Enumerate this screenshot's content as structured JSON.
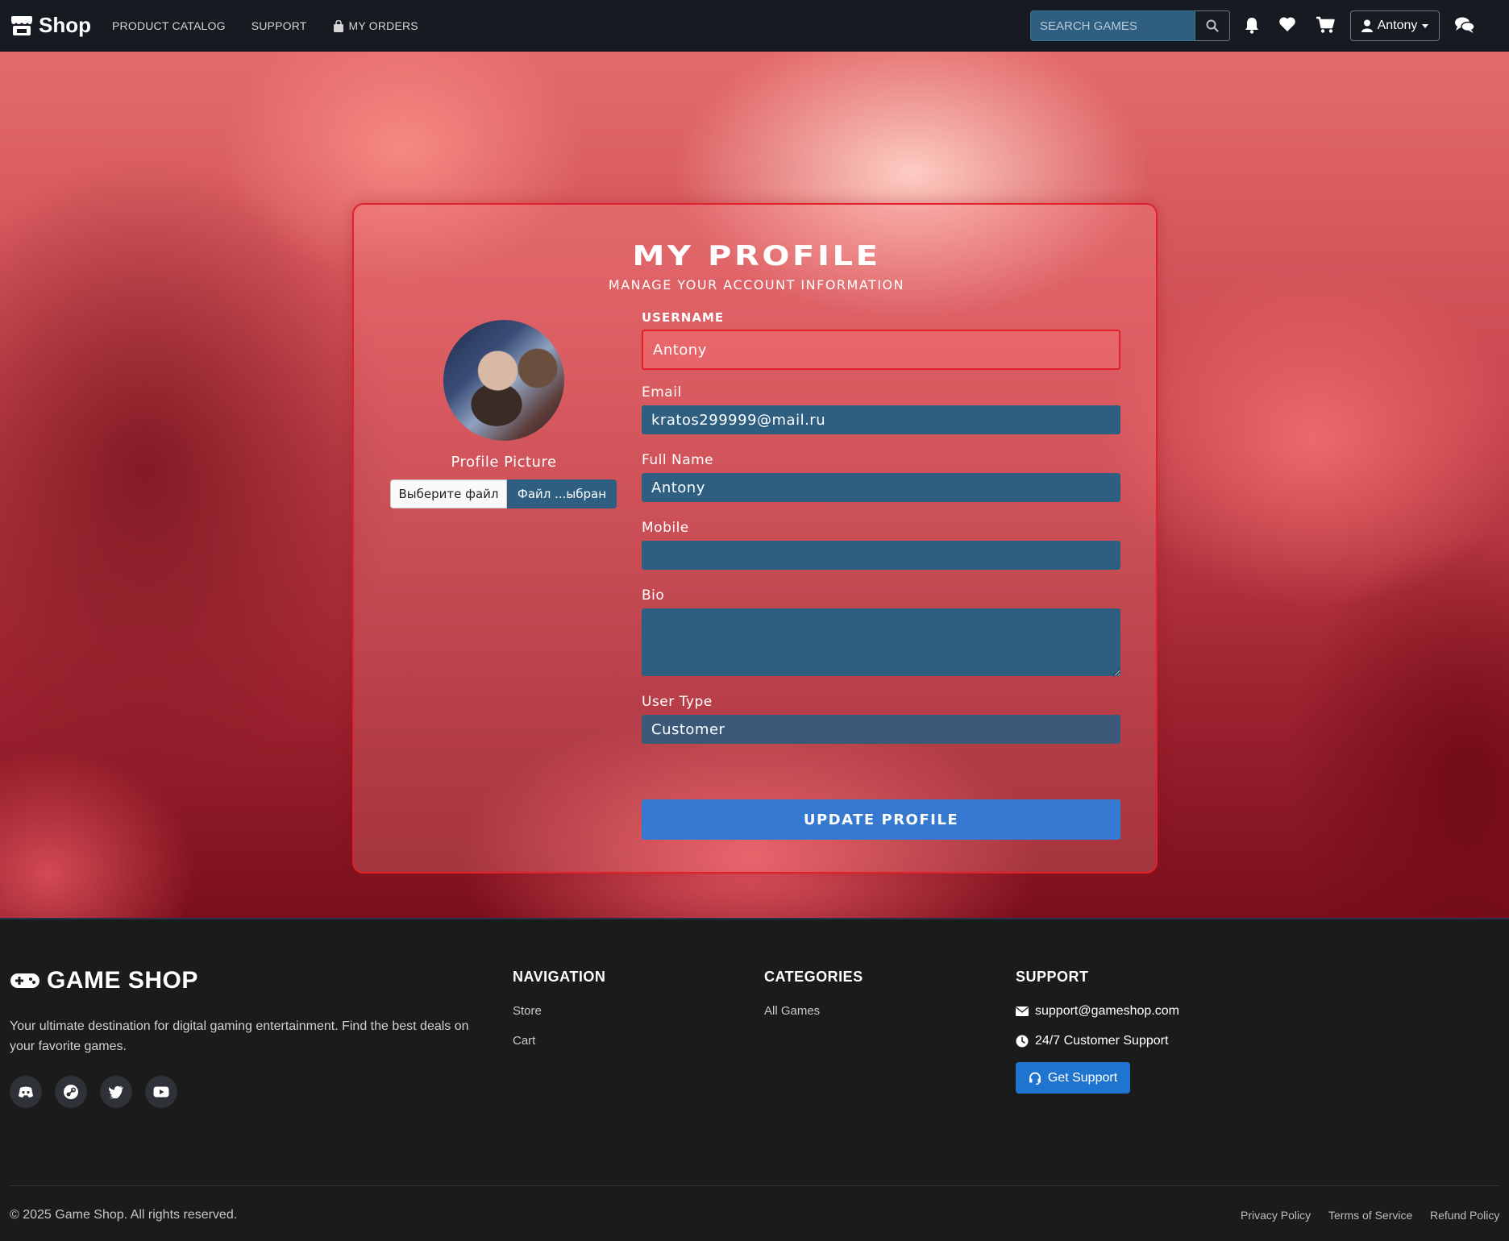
{
  "navbar": {
    "brand": "Shop",
    "links": [
      "PRODUCT CATALOG",
      "SUPPORT",
      "MY ORDERS"
    ],
    "search_placeholder": "SEARCH GAMES",
    "user_name": "Antony",
    "icons": [
      "store-icon",
      "bag-icon",
      "search-icon",
      "bell-icon",
      "heart-icon",
      "cart-icon",
      "user-icon",
      "chat-icon"
    ]
  },
  "profile": {
    "title": "MY PROFILE",
    "subtitle": "MANAGE YOUR ACCOUNT INFORMATION",
    "picture_label": "Profile Picture",
    "file_choose": "Выберите файл",
    "file_status": "Файл ...ыбран",
    "fields": {
      "username_label": "USERNAME",
      "username_value": "Antony",
      "email_label": "Email",
      "email_value": "kratos299999@mail.ru",
      "fullname_label": "Full Name",
      "fullname_value": "Antony",
      "mobile_label": "Mobile",
      "mobile_value": "",
      "bio_label": "Bio",
      "bio_value": "",
      "usertype_label": "User Type",
      "usertype_value": "Customer"
    },
    "submit": "UPDATE PROFILE"
  },
  "footer": {
    "brand": "GAME SHOP",
    "description": "Your ultimate destination for digital gaming entertainment. Find the best deals on your favorite games.",
    "social_icons": [
      "discord-icon",
      "steam-icon",
      "twitter-icon",
      "youtube-icon"
    ],
    "navigation_title": "NAVIGATION",
    "navigation_links": [
      "Store",
      "Cart"
    ],
    "categories_title": "CATEGORIES",
    "categories_links": [
      "All Games"
    ],
    "support_title": "SUPPORT",
    "support_email": "support@gameshop.com",
    "support_hours": "24/7 Customer Support",
    "support_button": "Get Support",
    "copyright": "© 2025 Game Shop. All rights reserved.",
    "legal_links": [
      "Privacy Policy",
      "Terms of Service",
      "Refund Policy"
    ]
  },
  "colors": {
    "navbar_bg": "#161b22",
    "accent_blue": "#3579d0",
    "field_bg": "#2e5f80",
    "card_border": "#e0202a",
    "footer_bg": "#1b1b1b"
  }
}
